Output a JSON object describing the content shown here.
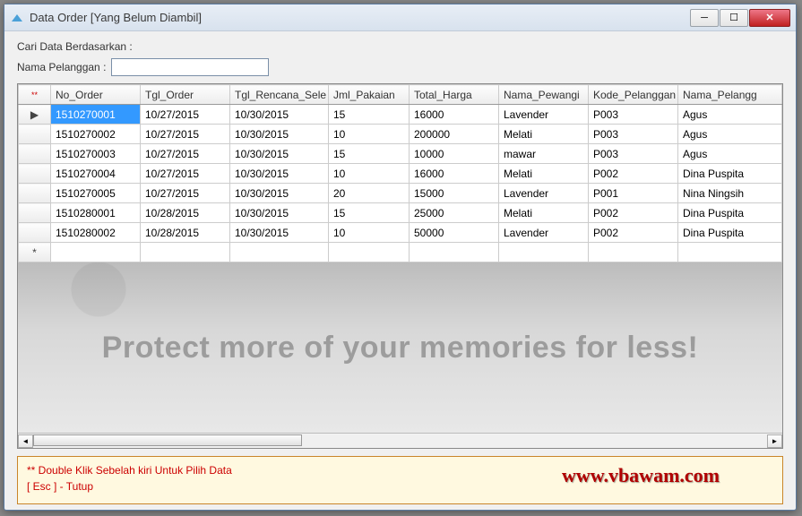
{
  "window": {
    "title": "Data Order [Yang Belum Diambil]"
  },
  "search": {
    "title": "Cari Data Berdasarkan :",
    "label": "Nama Pelanggan :",
    "value": ""
  },
  "grid": {
    "corner": "**",
    "headers": [
      "No_Order",
      "Tgl_Order",
      "Tgl_Rencana_Sele",
      "Jml_Pakaian",
      "Total_Harga",
      "Nama_Pewangi",
      "Kode_Pelanggan",
      "Nama_Pelangg"
    ],
    "rows": [
      {
        "sel": true,
        "cells": [
          "1510270001",
          "10/27/2015",
          "10/30/2015",
          "15",
          "16000",
          "Lavender",
          "P003",
          "Agus"
        ]
      },
      {
        "sel": false,
        "cells": [
          "1510270002",
          "10/27/2015",
          "10/30/2015",
          "10",
          "200000",
          "Melati",
          "P003",
          "Agus"
        ]
      },
      {
        "sel": false,
        "cells": [
          "1510270003",
          "10/27/2015",
          "10/30/2015",
          "15",
          "10000",
          "mawar",
          "P003",
          "Agus"
        ]
      },
      {
        "sel": false,
        "cells": [
          "1510270004",
          "10/27/2015",
          "10/30/2015",
          "10",
          "16000",
          "Melati",
          "P002",
          "Dina Puspita"
        ]
      },
      {
        "sel": false,
        "cells": [
          "1510270005",
          "10/27/2015",
          "10/30/2015",
          "20",
          "15000",
          "Lavender",
          "P001",
          "Nina Ningsih"
        ]
      },
      {
        "sel": false,
        "cells": [
          "1510280001",
          "10/28/2015",
          "10/30/2015",
          "15",
          "25000",
          "Melati",
          "P002",
          "Dina Puspita"
        ]
      },
      {
        "sel": false,
        "cells": [
          "1510280002",
          "10/28/2015",
          "10/30/2015",
          "10",
          "50000",
          "Lavender",
          "P002",
          "Dina Puspita"
        ]
      }
    ]
  },
  "watermark": "Protect more of your memories for less!",
  "footer": {
    "line1": "** Double Klik Sebelah kiri Untuk Pilih Data",
    "line2": "[ Esc ] - Tutup",
    "url": "www.vbawam.com"
  }
}
